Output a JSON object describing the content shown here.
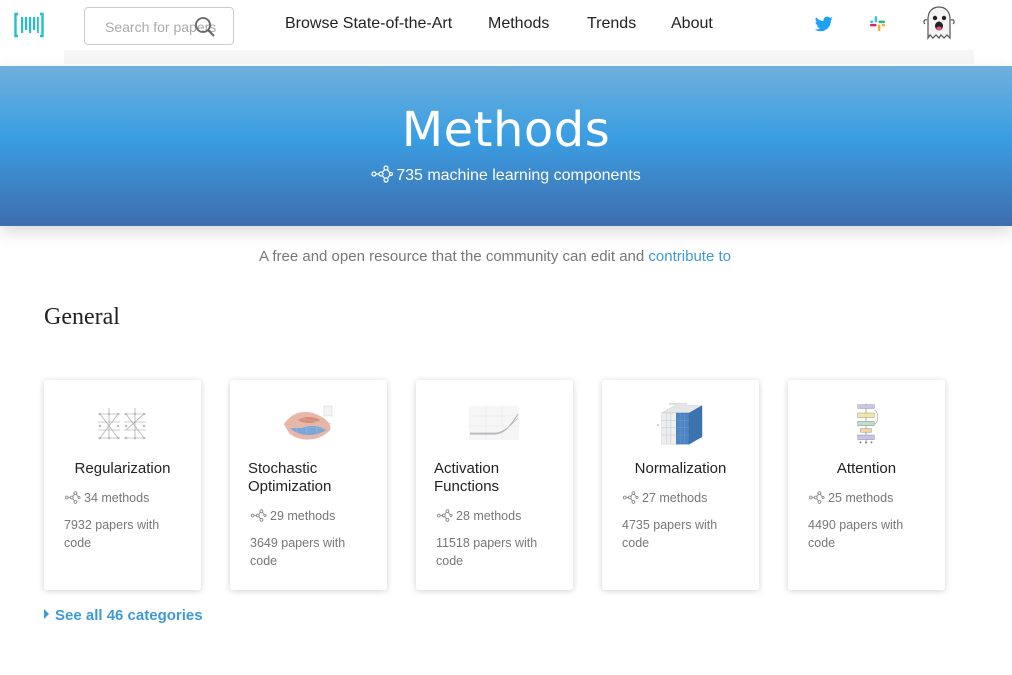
{
  "header": {
    "search_placeholder": "Search for papers, code and tasks",
    "nav": {
      "browse": "Browse State-of-the-Art",
      "methods": "Methods",
      "trends": "Trends",
      "about": "About"
    }
  },
  "hero": {
    "title": "Methods",
    "subtitle": "735 machine learning components"
  },
  "tagline": {
    "text": "A free and open resource that the community can edit and ",
    "link": "contribute to"
  },
  "section": {
    "title": "General"
  },
  "cards": [
    {
      "title": "Regularization",
      "methods": "34 methods",
      "papers": "7932 papers with code"
    },
    {
      "title": "Stochastic Optimization",
      "methods": "29 methods",
      "papers": "3649 papers with code"
    },
    {
      "title": "Activation Functions",
      "methods": "28 methods",
      "papers": "11518 papers with code"
    },
    {
      "title": "Normalization",
      "methods": "27 methods",
      "papers": "4735 papers with code"
    },
    {
      "title": "Attention",
      "methods": "25 methods",
      "papers": "4490 papers with code"
    }
  ],
  "see_all": "See all 46 categories",
  "colors": {
    "accent": "#3e9ad5",
    "logo": "#21c0c8",
    "twitter": "#1da1f2"
  },
  "icons": [
    "logo-icon",
    "search-icon",
    "twitter-icon",
    "slack-icon",
    "ghost-avatar",
    "network-icon"
  ]
}
